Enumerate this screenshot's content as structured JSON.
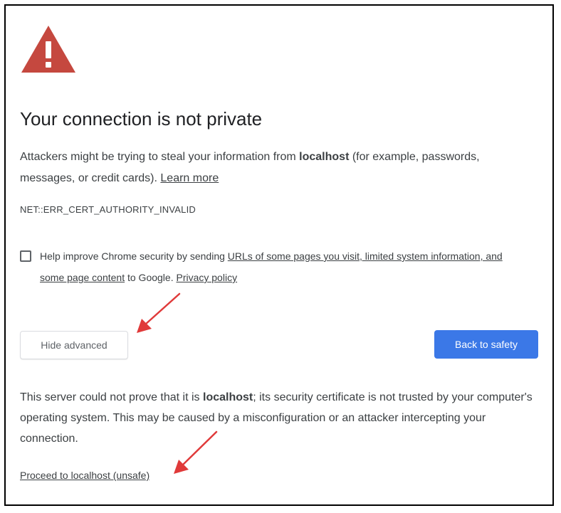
{
  "page": {
    "title": "Your connection is not private",
    "intro": {
      "part1": "Attackers might be trying to steal your information from ",
      "host": "localhost",
      "part2": " (for example, passwords, messages, or credit cards). ",
      "learn_more": "Learn more"
    },
    "error_code": "NET::ERR_CERT_AUTHORITY_INVALID",
    "report": {
      "checked": false,
      "part1": "Help improve Chrome security by sending ",
      "link1": "URLs of some pages you visit, limited system information, and some page content",
      "part2": " to Google. ",
      "privacy_link": "Privacy policy"
    },
    "buttons": {
      "hide_advanced": "Hide advanced",
      "back_to_safety": "Back to safety"
    },
    "details": {
      "part1": "This server could not prove that it is ",
      "host": "localhost",
      "part2": "; its security certificate is not trusted by your computer's operating system. This may be caused by a misconfiguration or an attacker intercepting your connection."
    },
    "proceed_link": "Proceed to localhost (unsafe)"
  },
  "colors": {
    "warning_icon": "#c5483f",
    "primary_button": "#3b78e7",
    "annotation_arrow": "#e03a3a"
  },
  "icons": {
    "warning": "warning-triangle-icon",
    "annotation": "red-arrow-annotation"
  }
}
